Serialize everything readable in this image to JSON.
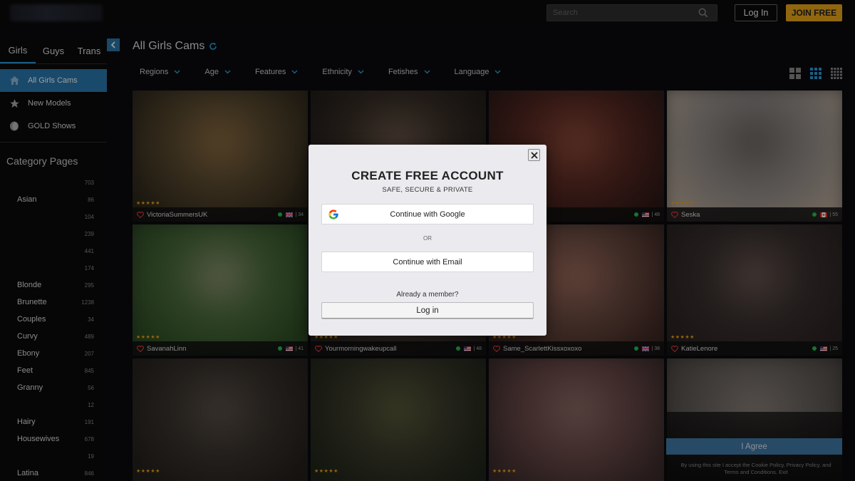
{
  "topbar": {
    "search_placeholder": "Search",
    "login_label": "Log In",
    "join_label": "JOIN FREE"
  },
  "sidebar": {
    "gender_tabs": [
      {
        "label": "Girls",
        "active": true
      },
      {
        "label": "Guys",
        "active": false
      },
      {
        "label": "Trans",
        "active": false
      }
    ],
    "nav": [
      {
        "label": "All Girls Cams",
        "icon": "home-icon",
        "active": true
      },
      {
        "label": "New Models",
        "icon": "star-icon",
        "active": false
      },
      {
        "label": "GOLD Shows",
        "icon": "gold-coin-icon",
        "active": false
      }
    ],
    "category_heading": "Category Pages",
    "categories": [
      {
        "name": "",
        "count": "703"
      },
      {
        "name": "Asian",
        "count": "86"
      },
      {
        "name": "",
        "count": "104"
      },
      {
        "name": "",
        "count": "239"
      },
      {
        "name": "",
        "count": "441"
      },
      {
        "name": "",
        "count": "174"
      },
      {
        "name": "Blonde",
        "count": "295"
      },
      {
        "name": "Brunette",
        "count": "1238"
      },
      {
        "name": "Couples",
        "count": "34"
      },
      {
        "name": "Curvy",
        "count": "489"
      },
      {
        "name": "Ebony",
        "count": "207"
      },
      {
        "name": "Feet",
        "count": "845"
      },
      {
        "name": "Granny",
        "count": "56"
      },
      {
        "name": "",
        "count": "12"
      },
      {
        "name": "Hairy",
        "count": "191"
      },
      {
        "name": "Housewives",
        "count": "678"
      },
      {
        "name": "",
        "count": "19"
      },
      {
        "name": "Latina",
        "count": "846"
      }
    ]
  },
  "main": {
    "title": "All Girls Cams",
    "filters": [
      "Regions",
      "Age",
      "Features",
      "Ethnicity",
      "Fetishes",
      "Language"
    ],
    "tiles": [
      {
        "name": "VictoriaSummersUK",
        "flag": "uk",
        "age": "34",
        "stars": "★★★★★",
        "colors": [
          "#5a4a30",
          "#2a2418",
          "#8a6a40"
        ]
      },
      {
        "name": "",
        "flag": "",
        "age": "",
        "stars": "",
        "colors": [
          "#3a3028",
          "#1c1814",
          "#6a5848"
        ]
      },
      {
        "name": "",
        "flag": "us",
        "age": "48",
        "stars": "",
        "colors": [
          "#5a2a22",
          "#2a1614",
          "#8a4a3a"
        ]
      },
      {
        "name": "Seska",
        "flag": "ca",
        "age": "55",
        "stars": "★★★★★",
        "colors": [
          "#8a8684",
          "#b8a898",
          "#6a625c"
        ]
      },
      {
        "name": "SavanahLinn",
        "flag": "us",
        "age": "41",
        "stars": "★★★★★",
        "colors": [
          "#4a6a3a",
          "#2a4a22",
          "#8a9070"
        ]
      },
      {
        "name": "Yourmorningwakeupcall",
        "flag": "us",
        "age": "48",
        "stars": "★★★★★",
        "colors": [
          "#4a4038",
          "#2a2420",
          "#6a5a48"
        ]
      },
      {
        "name": "Same_ScarlettKissxoxoxo",
        "flag": "uk",
        "age": "38",
        "stars": "★★★★★",
        "colors": [
          "#6a4a40",
          "#3a2420",
          "#9a6a5a"
        ]
      },
      {
        "name": "KatieLenore",
        "flag": "us",
        "age": "25",
        "stars": "★★★★★",
        "colors": [
          "#3a3230",
          "#2a2220",
          "#6a5650"
        ]
      },
      {
        "name": "",
        "flag": "",
        "age": "",
        "stars": "★★★★★",
        "colors": [
          "#3a342e",
          "#221e1a",
          "#5a5048"
        ]
      },
      {
        "name": "",
        "flag": "",
        "age": "",
        "stars": "★★★★★",
        "colors": [
          "#3a3a2a",
          "#1e2418",
          "#5a5a3a"
        ]
      },
      {
        "name": "",
        "flag": "",
        "age": "",
        "stars": "★★★★★",
        "colors": [
          "#6a4a48",
          "#3a2a2a",
          "#8a6a64"
        ]
      },
      {
        "name": "",
        "flag": "",
        "age": "",
        "stars": "",
        "colors": [
          "#6a6460",
          "#4a4440",
          "#8a8078"
        ]
      }
    ]
  },
  "modal": {
    "title": "CREATE FREE ACCOUNT",
    "subtitle": "SAFE, SECURE & PRIVATE",
    "google_label": "Continue with Google",
    "or_label": "OR",
    "email_label": "Continue with Email",
    "already_label": "Already a member?",
    "login_label": "Log in"
  },
  "consent": {
    "agree_label": "I Agree",
    "text": "By using this site I accept the Cookie Policy, Privacy Policy, and Terms and Conditions. Exit"
  },
  "colors": {
    "accent_blue": "#2a78ad",
    "join_gold": "#e9a519",
    "star_gold": "#e8a318",
    "online_green": "#1fbf4f"
  }
}
